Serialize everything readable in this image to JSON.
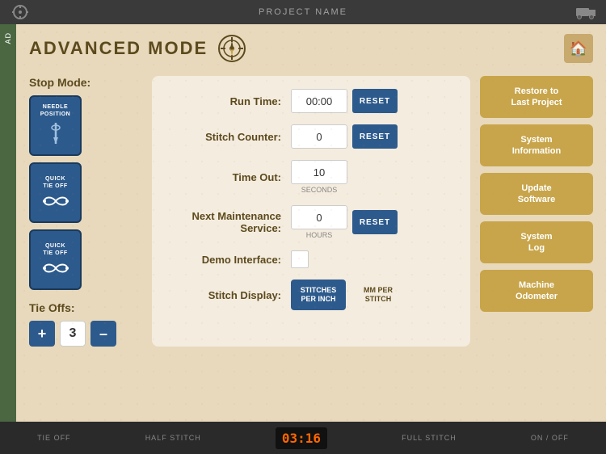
{
  "topBar": {
    "title": "PROJECT NAME",
    "leftIcon": "menu-icon",
    "rightIcon": "truck-icon"
  },
  "header": {
    "title": "ADVANCED MODE",
    "homeButton": "🏠"
  },
  "leftStrip": {
    "text": "AD"
  },
  "stopMode": {
    "label": "Stop Mode:",
    "buttons": [
      {
        "line1": "NEEDLE",
        "line2": "POSITION",
        "icon": "needle"
      },
      {
        "line1": "QUICK",
        "line2": "TIE OFF",
        "icon": "knot"
      },
      {
        "line1": "QUICK",
        "line2": "TIE OFF",
        "icon": "knot2"
      }
    ]
  },
  "tieOffs": {
    "label": "Tie Offs:",
    "count": "3",
    "decrementLabel": "–",
    "incrementLabel": "+"
  },
  "form": {
    "runTime": {
      "label": "Run Time:",
      "value": "00:00",
      "resetLabel": "RESET"
    },
    "stitchCounter": {
      "label": "Stitch Counter:",
      "value": "0",
      "resetLabel": "RESET"
    },
    "timeOut": {
      "label": "Time Out:",
      "value": "10",
      "subLabel": "SECONDS"
    },
    "nextMaintenance": {
      "label": "Next Maintenance Service:",
      "value": "0",
      "subLabel": "HOURS",
      "resetLabel": "RESET"
    },
    "demoInterface": {
      "label": "Demo Interface:"
    },
    "stitchDisplay": {
      "label": "Stitch Display:",
      "options": [
        {
          "text": "STITCHES PER INCH",
          "active": true
        },
        {
          "text": "MM PER STITCH",
          "active": false
        }
      ]
    }
  },
  "rightButtons": [
    {
      "label": "Restore to\nLast Project"
    },
    {
      "label": "System\nInformation"
    },
    {
      "label": "Update\nSoftware"
    },
    {
      "label": "System\nLog"
    },
    {
      "label": "Machine\nOdometer"
    }
  ],
  "bottomBar": {
    "items": [
      "TIE OFF",
      "HALF STITCH",
      "FULL STITCH",
      "ON / OFF"
    ],
    "clock": "03:16"
  }
}
